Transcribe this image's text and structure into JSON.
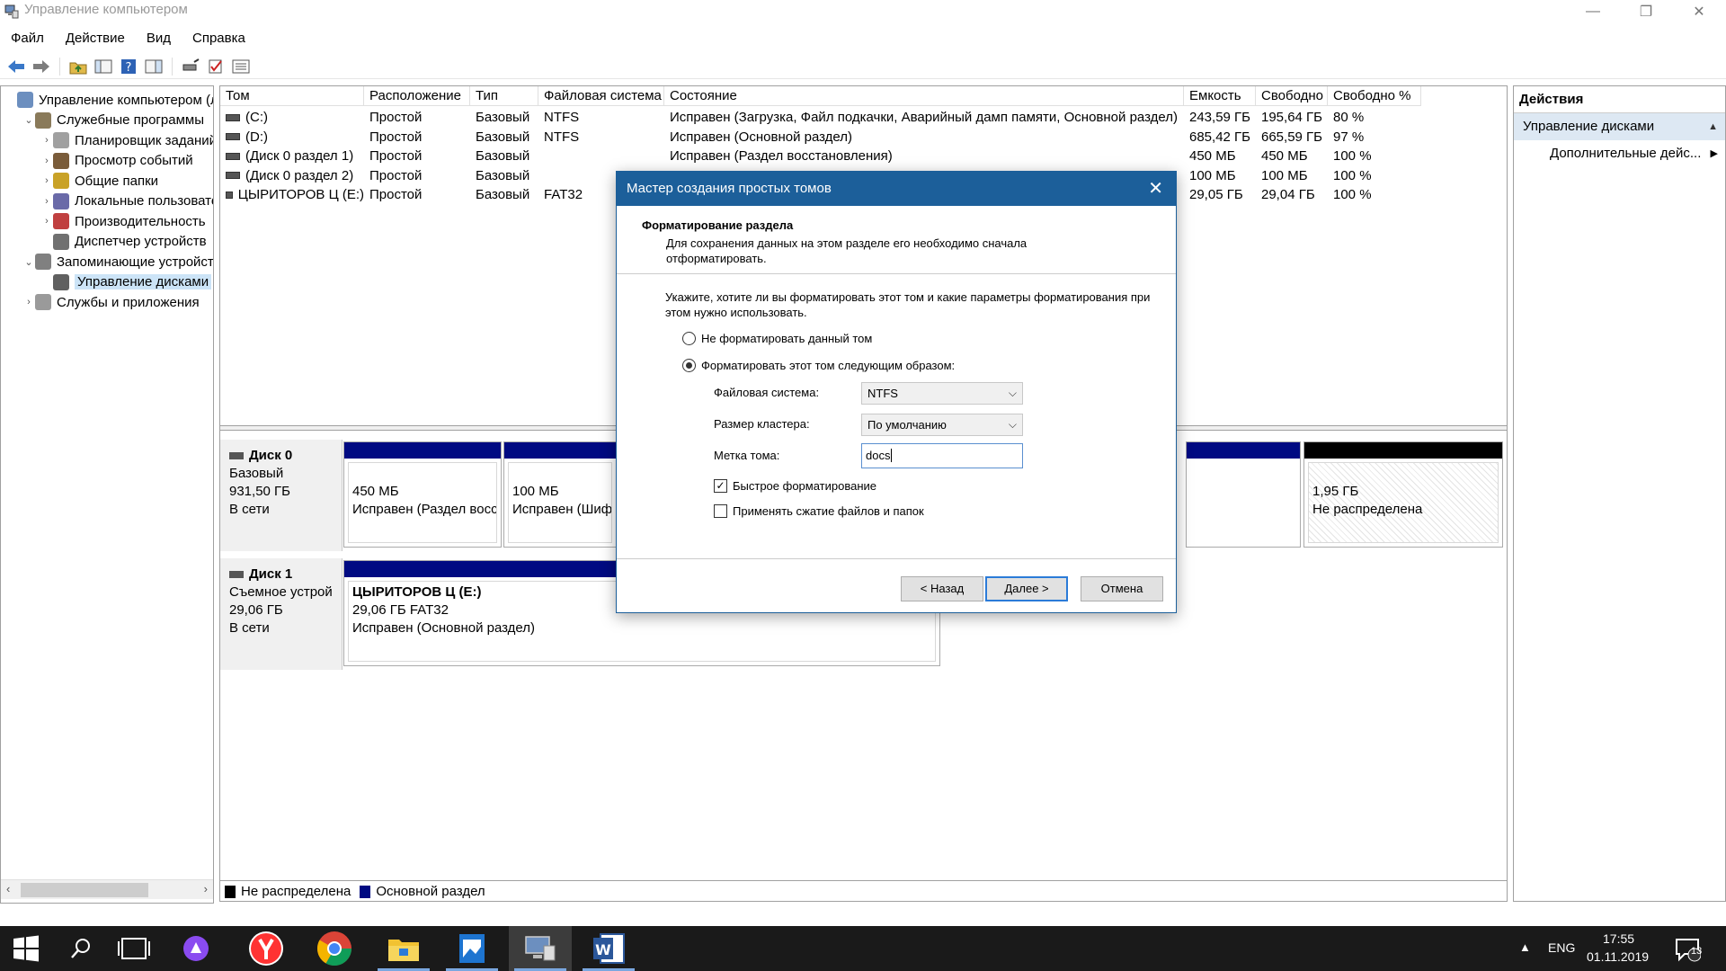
{
  "window": {
    "title": "Управление компьютером"
  },
  "menu": [
    "Файл",
    "Действие",
    "Вид",
    "Справка"
  ],
  "tree": [
    {
      "label": "Управление компьютером (лс",
      "level": 0,
      "expander": ""
    },
    {
      "label": "Служебные программы",
      "level": 1,
      "expander": "v"
    },
    {
      "label": "Планировщик заданий",
      "level": 2,
      "expander": ">"
    },
    {
      "label": "Просмотр событий",
      "level": 2,
      "expander": ">"
    },
    {
      "label": "Общие папки",
      "level": 2,
      "expander": ">"
    },
    {
      "label": "Локальные пользовате",
      "level": 2,
      "expander": ">"
    },
    {
      "label": "Производительность",
      "level": 2,
      "expander": ">"
    },
    {
      "label": "Диспетчер устройств",
      "level": 2,
      "expander": ""
    },
    {
      "label": "Запоминающие устройств",
      "level": 1,
      "expander": "v"
    },
    {
      "label": "Управление дисками",
      "level": 2,
      "expander": "",
      "selected": true
    },
    {
      "label": "Службы и приложения",
      "level": 1,
      "expander": ">"
    }
  ],
  "volumes": {
    "columns": [
      "Том",
      "Расположение",
      "Тип",
      "Файловая система",
      "Состояние",
      "Емкость",
      "Свободно",
      "Свободно %"
    ],
    "rows": [
      [
        "(C:)",
        "Простой",
        "Базовый",
        "NTFS",
        "Исправен (Загрузка, Файл подкачки, Аварийный дамп памяти, Основной раздел)",
        "243,59 ГБ",
        "195,64 ГБ",
        "80 %"
      ],
      [
        "(D:)",
        "Простой",
        "Базовый",
        "NTFS",
        "Исправен (Основной раздел)",
        "685,42 ГБ",
        "665,59 ГБ",
        "97 %"
      ],
      [
        "(Диск 0 раздел 1)",
        "Простой",
        "Базовый",
        "",
        "Исправен (Раздел восстановления)",
        "450 МБ",
        "450 МБ",
        "100 %"
      ],
      [
        "(Диск 0 раздел 2)",
        "Простой",
        "Базовый",
        "",
        "",
        "100 МБ",
        "100 МБ",
        "100 %"
      ],
      [
        "ЦЫРИТОРОВ Ц (E:)",
        "Простой",
        "Базовый",
        "FAT32",
        "",
        "29,05 ГБ",
        "29,04 ГБ",
        "100 %"
      ]
    ]
  },
  "disks": [
    {
      "name": "Диск 0",
      "type": "Базовый",
      "size": "931,50 ГБ",
      "status": "В сети",
      "partitions": [
        {
          "title": "",
          "line1": "450 МБ",
          "line2": "Исправен (Раздел восс",
          "color": "#000a82"
        },
        {
          "title": "",
          "line1": "100 МБ",
          "line2": "Исправен (Шифр",
          "color": "#000a82"
        },
        {
          "title": "",
          "line1": "1,95 ГБ",
          "line2": "Не распределена",
          "color": "#000000"
        }
      ]
    },
    {
      "name": "Диск 1",
      "type": "Съемное устрой",
      "size": "29,06 ГБ",
      "status": "В сети",
      "partitions": [
        {
          "title": "ЦЫРИТОРОВ Ц  (E:)",
          "line1": "29,06 ГБ FAT32",
          "line2": "Исправен (Основной раздел)",
          "color": "#000a82"
        }
      ]
    }
  ],
  "legend": [
    {
      "label": "Не распределена",
      "color": "#000000"
    },
    {
      "label": "Основной раздел",
      "color": "#000a82"
    }
  ],
  "actions": {
    "title": "Действия",
    "section": "Управление дисками",
    "item": "Дополнительные дейс..."
  },
  "dialog": {
    "title": "Мастер создания простых томов",
    "header_title": "Форматирование раздела",
    "header_desc": "Для сохранения данных на этом разделе его необходимо сначала отформатировать.",
    "desc": "Укажите, хотите ли вы форматировать этот том и какие параметры форматирования при этом нужно использовать.",
    "radio_no_format": "Не форматировать данный том",
    "radio_format": "Форматировать этот том следующим образом:",
    "fs_label": "Файловая система:",
    "fs_value": "NTFS",
    "cluster_label": "Размер кластера:",
    "cluster_value": "По умолчанию",
    "volume_label": "Метка тома:",
    "volume_value": "docs",
    "quick_format": "Быстрое форматирование",
    "quick_format_checked": true,
    "compress": "Применять сжатие файлов и папок",
    "compress_checked": false,
    "btn_back": "< Назад",
    "btn_next": "Далее >",
    "btn_cancel": "Отмена"
  },
  "taskbar": {
    "lang": "ENG",
    "time": "17:55",
    "date": "01.11.2019",
    "notifications": "13"
  }
}
